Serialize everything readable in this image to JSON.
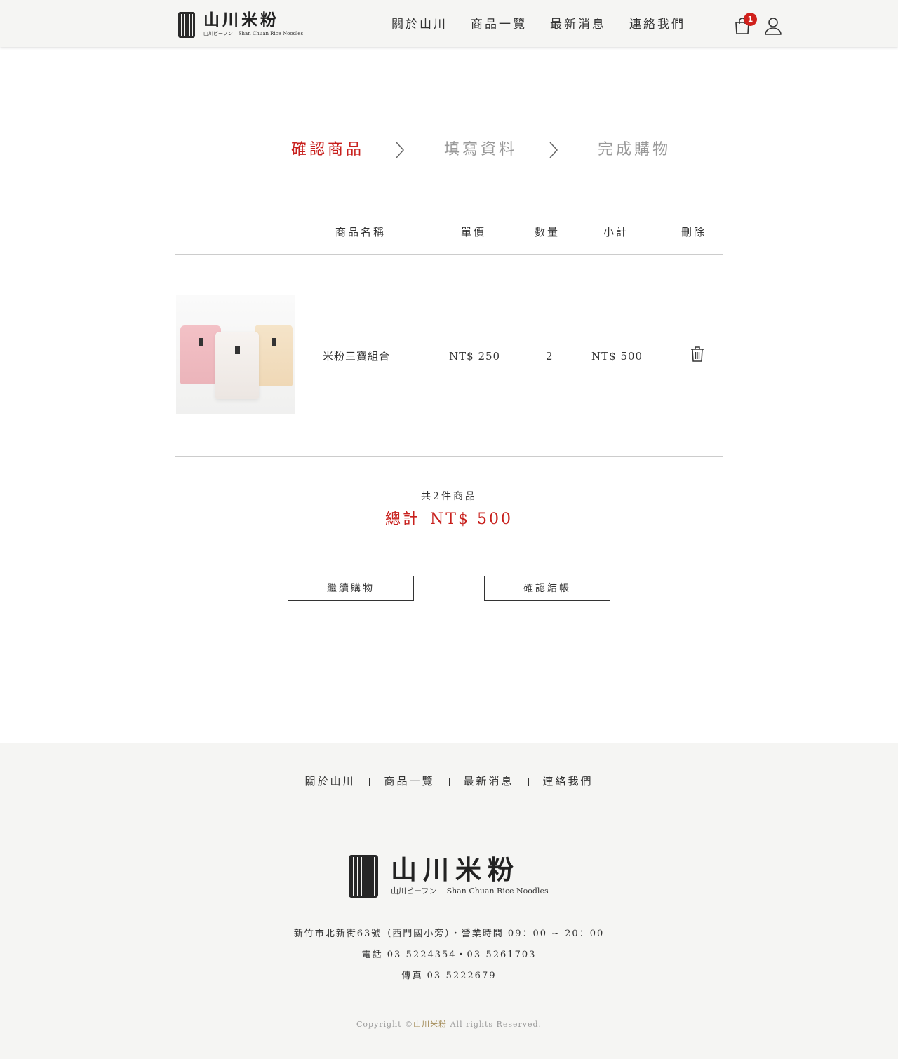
{
  "header": {
    "logo_main": "山川米粉",
    "logo_sub_jp": "山川ビーフン",
    "logo_sub_en": "Shan Chuan Rice Noodles",
    "nav": [
      "關於山川",
      "商品一覽",
      "最新消息",
      "連絡我們"
    ],
    "cart_count": "1"
  },
  "steps": [
    "確認商品",
    "填寫資料",
    "完成購物"
  ],
  "table": {
    "headers": [
      "商品名稱",
      "單價",
      "數量",
      "小計",
      "刪除"
    ],
    "rows": [
      {
        "name": "米粉三寶組合",
        "price": "NT$ 250",
        "qty": "2",
        "subtotal": "NT$ 500"
      }
    ]
  },
  "summary": {
    "count_text": "共2件商品",
    "total_label": "總計",
    "total_value": "NT$ 500"
  },
  "buttons": {
    "continue": "繼續購物",
    "checkout": "確認結帳"
  },
  "footer": {
    "nav": [
      "關於山川",
      "商品一覽",
      "最新消息",
      "連絡我們"
    ],
    "logo_main": "山川米粉",
    "logo_sub_jp": "山川ビーフン",
    "logo_sub_en": "Shan Chuan Rice Noodles",
    "address": "新竹市北新街63號（西門國小旁）・營業時間 09：00 ~ 20：00",
    "phone": "電話 03-5224354・03-5261703",
    "fax": "傳真 03-5222679",
    "copyright_prefix": "Copyright ©",
    "copyright_brand": "山川米粉",
    "copyright_suffix": " All rights Reserved."
  },
  "colors": {
    "accent": "#c8201d",
    "header_bg": "#f5f5f3",
    "footer_bg": "#f5f5f3",
    "badge": "#d0211c"
  }
}
